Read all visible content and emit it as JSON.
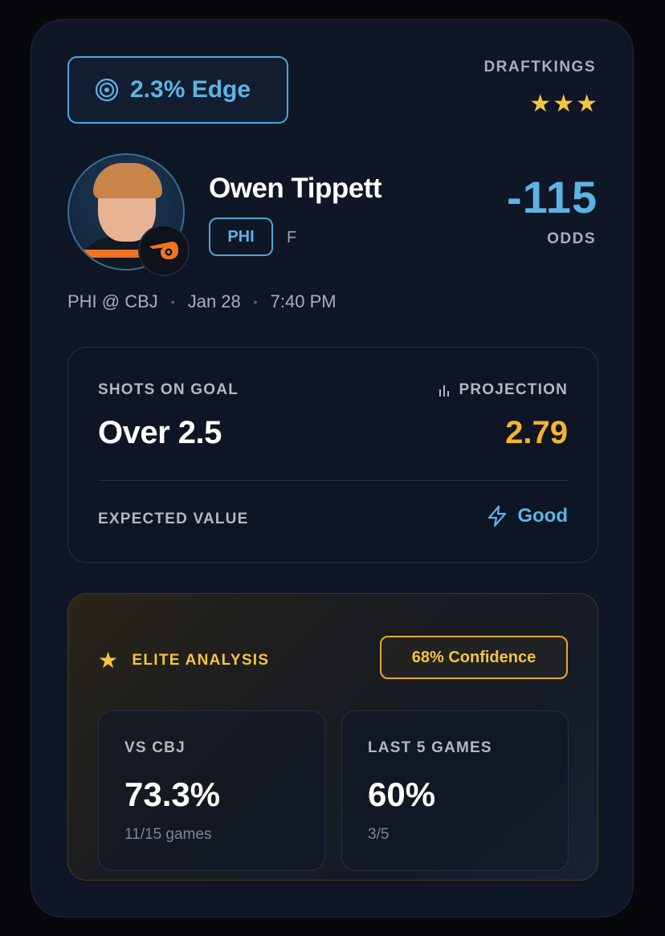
{
  "edge": {
    "label": "2.3% Edge",
    "icon": "target-icon"
  },
  "book": {
    "name": "DRAFTKINGS",
    "rating_stars": 3
  },
  "player": {
    "name": "Owen Tippett",
    "team": "PHI",
    "position": "F",
    "team_logo_icon": "flyers-logo-icon"
  },
  "odds": {
    "value": "-115",
    "label": "ODDS"
  },
  "game": {
    "matchup": "PHI @ CBJ",
    "date": "Jan 28",
    "time": "7:40 PM"
  },
  "prop": {
    "market": "SHOTS ON GOAL",
    "line": "Over 2.5",
    "projection_label": "PROJECTION",
    "projection_value": "2.79",
    "ev_label": "EXPECTED VALUE",
    "ev_value": "Good"
  },
  "elite": {
    "title": "ELITE ANALYSIS",
    "confidence": "68% Confidence",
    "stats": [
      {
        "label": "VS CBJ",
        "value": "73.3%",
        "sub": "11/15 games"
      },
      {
        "label": "LAST 5 GAMES",
        "value": "60%",
        "sub": "3/5"
      }
    ]
  },
  "colors": {
    "accent_blue": "#5db3e6",
    "gold": "#f4c542",
    "projection": "#f4b52a",
    "card_bg": "#0f1626"
  }
}
